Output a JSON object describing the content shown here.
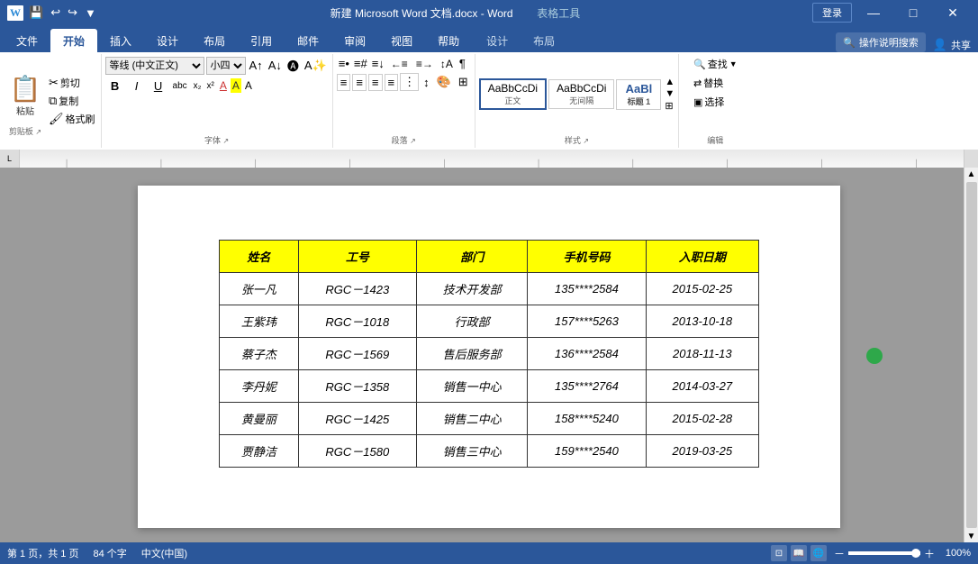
{
  "titleBar": {
    "title": "新建 Microsoft Word 文档.docx - Word",
    "tableToolsLabel": "表格工具",
    "loginLabel": "登录",
    "windowButtons": [
      "—",
      "□",
      "✕"
    ]
  },
  "tabs": [
    {
      "label": "文件",
      "active": false
    },
    {
      "label": "开始",
      "active": true
    },
    {
      "label": "插入",
      "active": false
    },
    {
      "label": "设计",
      "active": false
    },
    {
      "label": "布局",
      "active": false
    },
    {
      "label": "引用",
      "active": false
    },
    {
      "label": "邮件",
      "active": false
    },
    {
      "label": "审阅",
      "active": false
    },
    {
      "label": "视图",
      "active": false
    },
    {
      "label": "帮助",
      "active": false
    },
    {
      "label": "设计",
      "active": false
    },
    {
      "label": "布局",
      "active": false
    }
  ],
  "ribbon": {
    "groups": [
      {
        "label": "剪贴板"
      },
      {
        "label": "字体"
      },
      {
        "label": "段落"
      },
      {
        "label": "样式"
      },
      {
        "label": "编辑"
      }
    ],
    "fontName": "等线 (中文正)",
    "fontSize": "小四",
    "searchPlaceholder": "查找",
    "replaceLabel": "替换",
    "selectLabel": "选择",
    "styles": [
      {
        "label": "正文",
        "active": true
      },
      {
        "label": "无间隔"
      },
      {
        "label": "标题 1"
      }
    ]
  },
  "table": {
    "headers": [
      "姓名",
      "工号",
      "部门",
      "手机号码",
      "入职日期"
    ],
    "rows": [
      {
        "name": "张一凡",
        "id": "RGC－1423",
        "dept": "技术开发部",
        "phone": "135****2584",
        "date": "2015-02-25"
      },
      {
        "name": "王紫玮",
        "id": "RGC－1018",
        "dept": "行政部",
        "phone": "157****5263",
        "date": "2013-10-18"
      },
      {
        "name": "蔡子杰",
        "id": "RGC－1569",
        "dept": "售后服务部",
        "phone": "136****2584",
        "date": "2018-11-13"
      },
      {
        "name": "李丹妮",
        "id": "RGC－1358",
        "dept": "销售一中心",
        "phone": "135****2764",
        "date": "2014-03-27"
      },
      {
        "name": "黄曼丽",
        "id": "RGC－1425",
        "dept": "销售二中心",
        "phone": "158****5240",
        "date": "2015-02-28"
      },
      {
        "name": "贾静洁",
        "id": "RGC－1580",
        "dept": "销售三中心",
        "phone": "159****2540",
        "date": "2019-03-25"
      }
    ]
  },
  "statusBar": {
    "pageInfo": "第 1 页，共 1 页",
    "charCount": "84 个字",
    "language": "中文(中国)",
    "zoom": "100%"
  },
  "icons": {
    "save": "💾",
    "undo": "↩",
    "redo": "↪",
    "search": "🔍",
    "paste": "📋",
    "copy": "⧉",
    "cut": "✂",
    "formatPainter": "🖌",
    "bold": "B",
    "italic": "I",
    "underline": "U",
    "strikethrough": "S",
    "subscript": "x₁",
    "superscript": "x¹",
    "fontColor": "A",
    "highlight": "🖊",
    "alignLeft": "≡",
    "alignCenter": "≡",
    "alignRight": "≡",
    "justify": "≡",
    "lineSpacing": "↕",
    "bullets": "≡",
    "numbering": "≡",
    "indent": "→",
    "outdent": "←",
    "sort": "↕",
    "showMarks": "¶"
  }
}
